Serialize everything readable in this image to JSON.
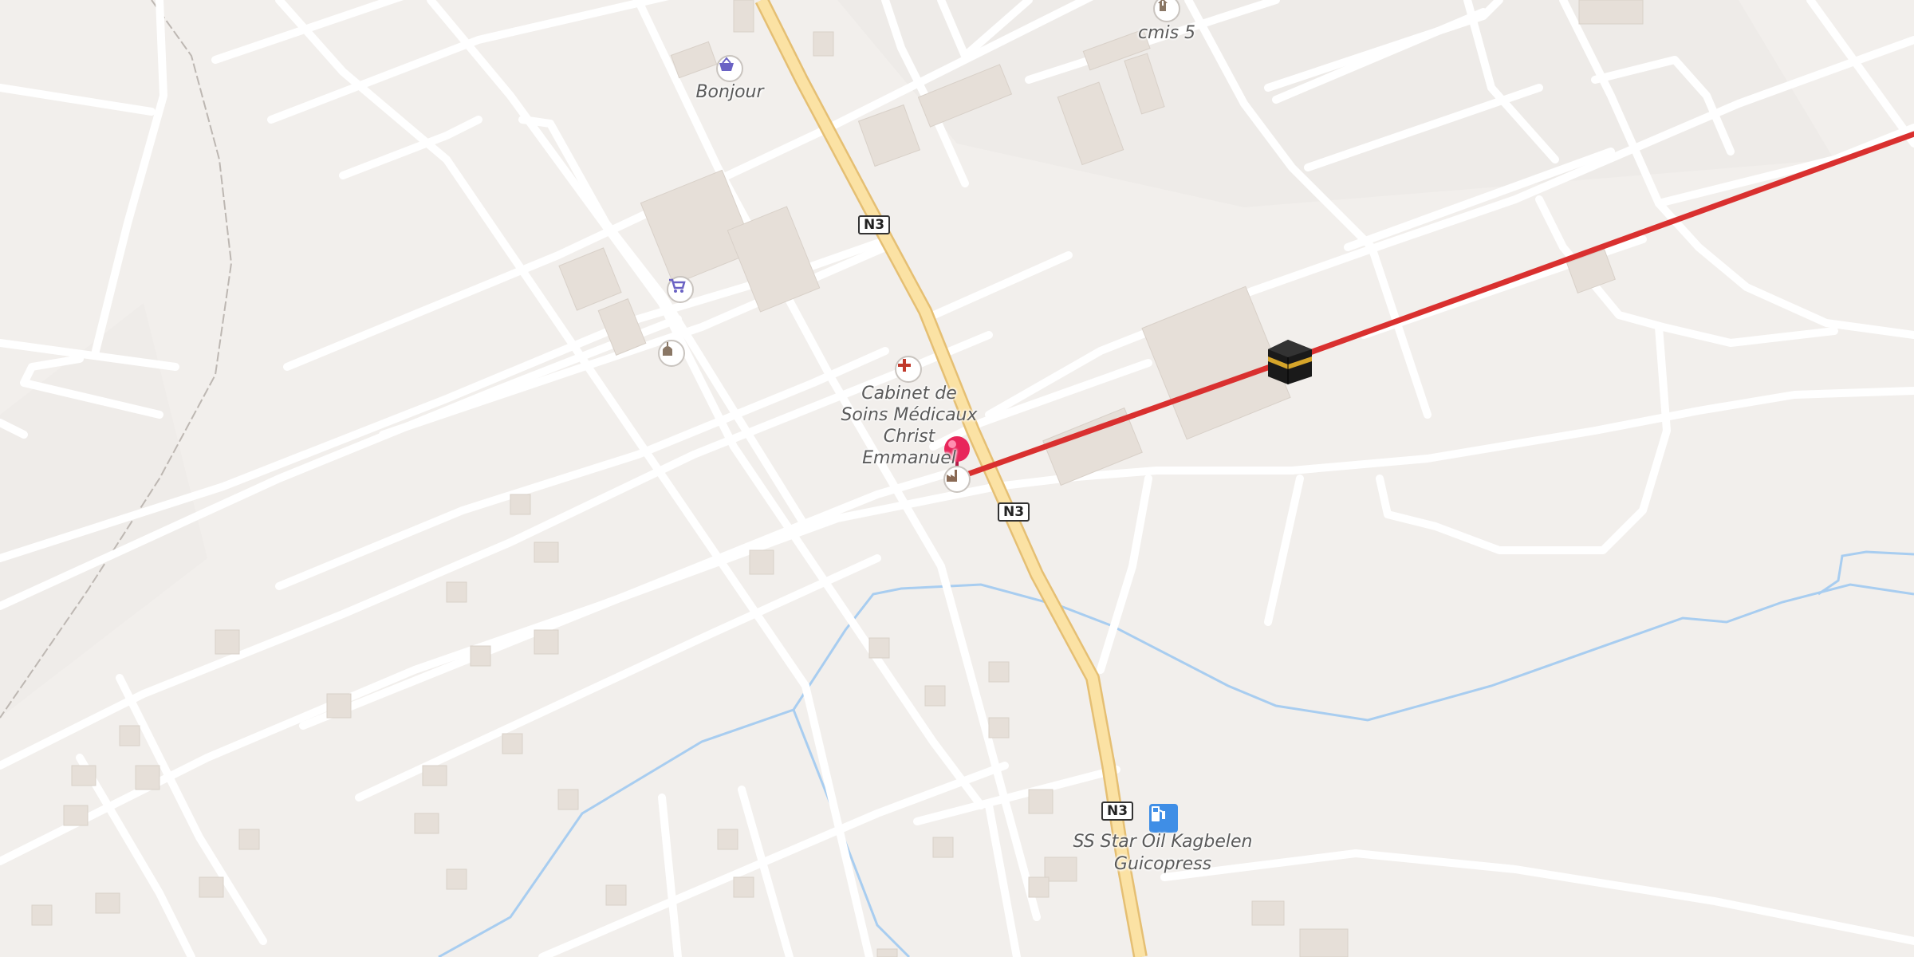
{
  "map": {
    "labels": {
      "cmis5": "cmis 5",
      "bonjour": "Bonjour",
      "cabinet": "Cabinet de Soins Médicaux Christ Emmanuel",
      "starOil": "SS Star Oil Kagbelen",
      "guicopress": "Guicopress"
    },
    "road_shields": [
      "N3",
      "N3",
      "N3"
    ],
    "icons": {
      "bonjour": "shopping-basket-icon",
      "supermarket": "shopping-cart-icon",
      "cmis5": "religious-building-icon",
      "mosque": "mosque-icon",
      "clinic": "medical-cross-icon",
      "factory": "factory-icon",
      "fuel": "fuel-station-icon",
      "destination": "kaaba-icon",
      "location_pin": "location-pin-icon"
    },
    "colors": {
      "background": "#f2efec",
      "road": "#ffffff",
      "main_road": "#fbe2a4",
      "water": "#a8cdf0",
      "route_line": "#d9302f",
      "pin": "#e8265b",
      "fuel": "#3f8ee6"
    }
  }
}
